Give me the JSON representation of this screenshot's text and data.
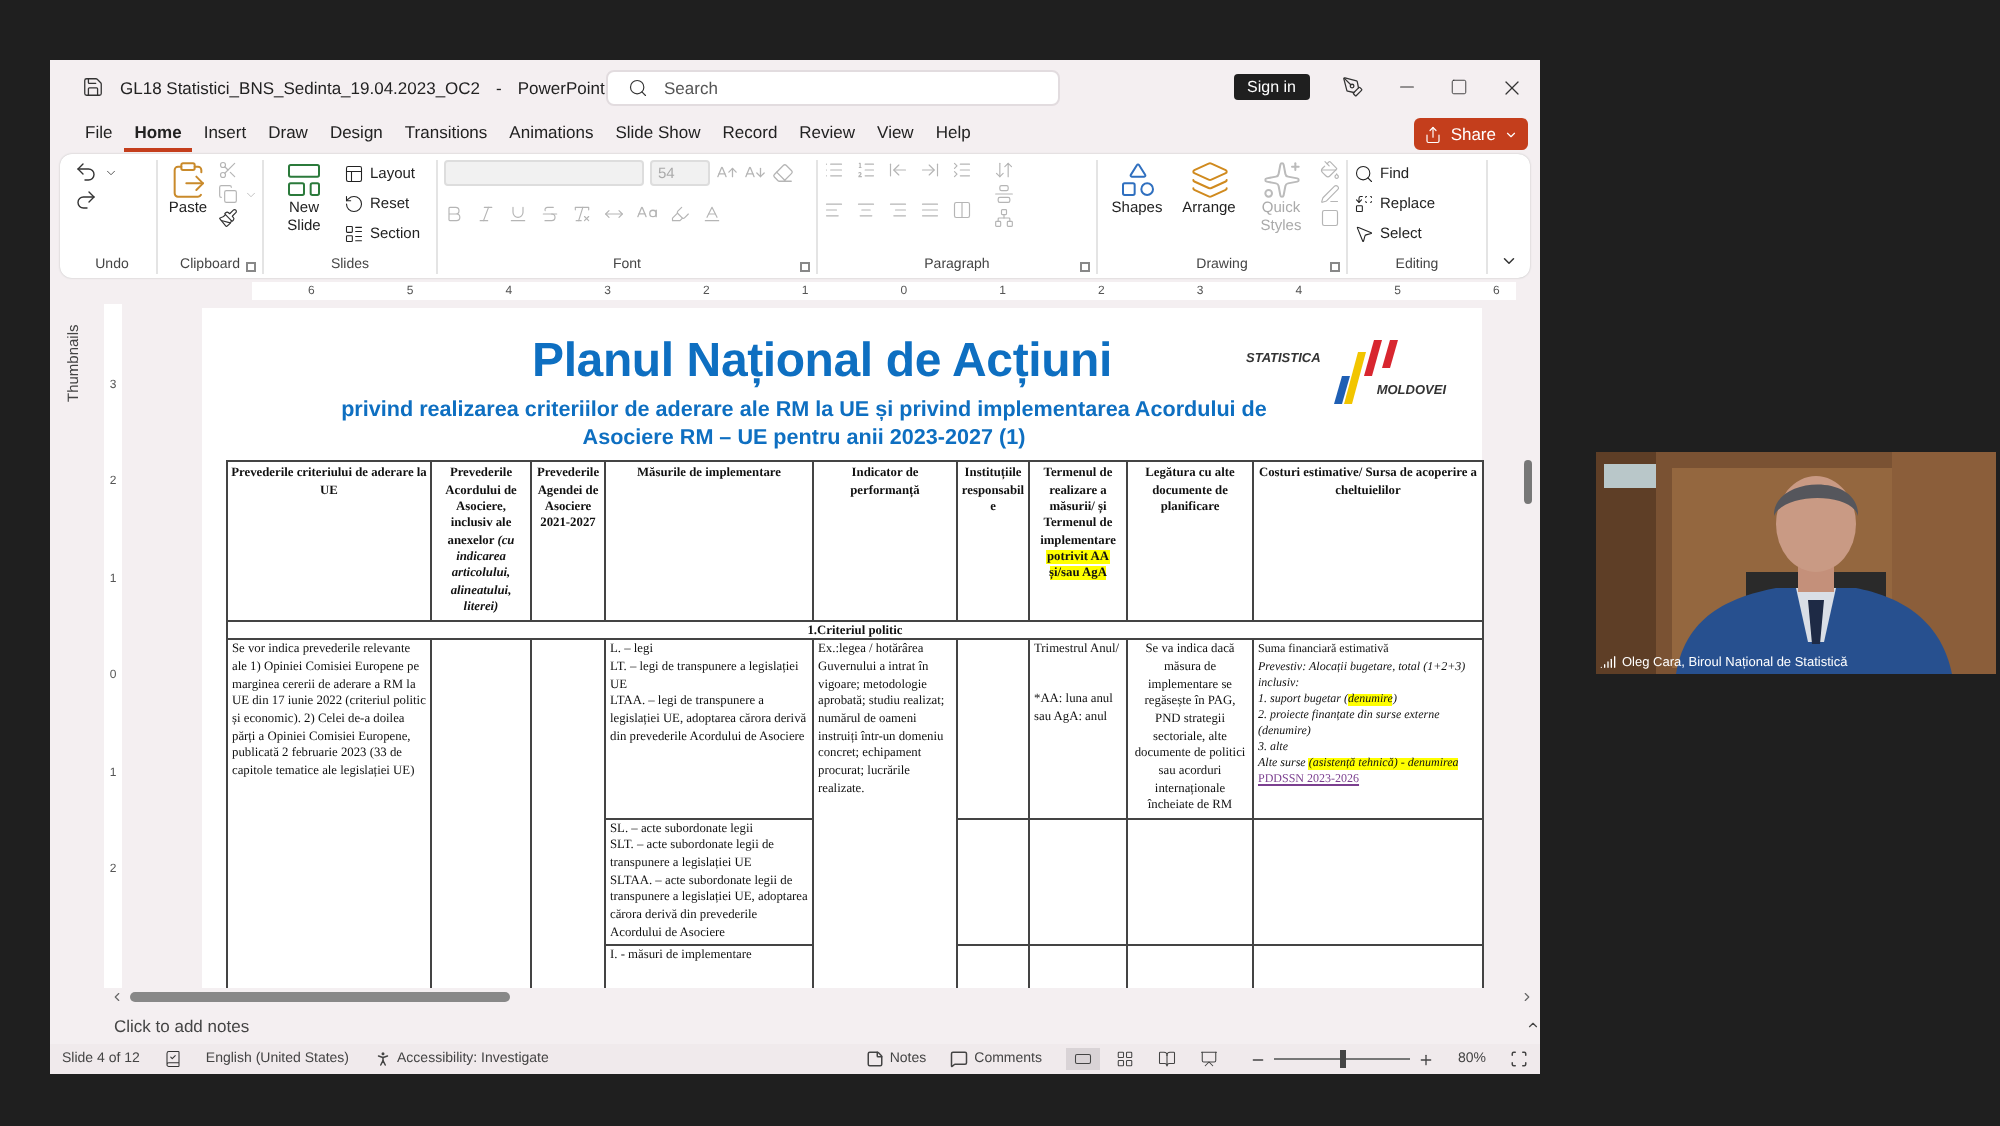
{
  "window": {
    "title": "GL18 Statistici_BNS_Sedinta_19.04.2023_OC2",
    "separator": "-",
    "app": "PowerPoint"
  },
  "search": {
    "placeholder": "Search"
  },
  "sign_in": "Sign in",
  "menu_tabs": [
    {
      "label": "File",
      "selected": false
    },
    {
      "label": "Home",
      "selected": true
    },
    {
      "label": "Insert",
      "selected": false
    },
    {
      "label": "Draw",
      "selected": false
    },
    {
      "label": "Design",
      "selected": false
    },
    {
      "label": "Transitions",
      "selected": false
    },
    {
      "label": "Animations",
      "selected": false
    },
    {
      "label": "Slide Show",
      "selected": false
    },
    {
      "label": "Record",
      "selected": false
    },
    {
      "label": "Review",
      "selected": false
    },
    {
      "label": "View",
      "selected": false
    },
    {
      "label": "Help",
      "selected": false
    }
  ],
  "share": "Share",
  "ribbon": {
    "undo": {
      "label": "Undo"
    },
    "clipboard": {
      "label": "Clipboard",
      "paste": "Paste"
    },
    "slides": {
      "label": "Slides",
      "new_slide": "New Slide",
      "layout": "Layout",
      "reset": "Reset",
      "section": "Section"
    },
    "font": {
      "label": "Font",
      "size": "54",
      "disabled": true
    },
    "paragraph": {
      "label": "Paragraph"
    },
    "drawing": {
      "label": "Drawing",
      "shapes": "Shapes",
      "arrange": "Arrange",
      "quick_styles": {
        "label": "Quick Styles",
        "disabled": true
      }
    },
    "editing": {
      "label": "Editing",
      "find": "Find",
      "replace": "Replace",
      "select": "Select"
    }
  },
  "thumbnails_pane": {
    "label": "Thumbnails"
  },
  "rulers": {
    "horizontal": [
      "6",
      "5",
      "4",
      "3",
      "2",
      "1",
      "0",
      "1",
      "2",
      "3",
      "4",
      "5",
      "6"
    ],
    "vertical": [
      "3",
      "2",
      "1",
      "0",
      "1",
      "2"
    ]
  },
  "slide": {
    "title": "Planul Național de Acțiuni",
    "subtitle": "privind realizarea criteriilor de aderare ale RM la UE și privind implementarea Acordului de Asociere RM – UE pentru anii 2023-2027 (1)",
    "logo": {
      "top": "STATISTICA",
      "bottom": "MOLDOVEI"
    },
    "table": {
      "columns": [
        {
          "segments": [
            {
              "text": "Prevederile criteriului de aderare la UE",
              "highlight": false
            }
          ]
        },
        {
          "segments": [
            {
              "text": "Prevederile Acordului de Asociere, inclusiv ale anexelor *(cu indicarea articolului, alineatului, literei)*",
              "highlight": false
            }
          ]
        },
        {
          "segments": [
            {
              "text": "Prevederile Agendei de Asociere 2021-2027",
              "highlight": false
            }
          ]
        },
        {
          "segments": [
            {
              "text": "Măsurile de implementare",
              "highlight": false
            }
          ]
        },
        {
          "segments": [
            {
              "text": "Indicator de performanță",
              "highlight": false
            }
          ]
        },
        {
          "segments": [
            {
              "text": "Instituțiile responsabile",
              "highlight": false
            }
          ]
        },
        {
          "segments": [
            {
              "text": "Termenul de realizare a măsurii/ și Termenul de implementare ",
              "highlight": false
            },
            {
              "text": "potrivit AA și/sau AgA",
              "highlight": true
            }
          ]
        },
        {
          "segments": [
            {
              "text": "Legătura cu alte documente de planificare",
              "highlight": false
            }
          ]
        },
        {
          "segments": [
            {
              "text": "Costuri estimative/ Sursa de acoperire a cheltuielilor",
              "highlight": false
            }
          ]
        }
      ],
      "section": "1.Criteriul politic",
      "body": {
        "criteria": "Se vor indica prevederile relevante ale 1) Opiniei Comisiei Europene pe marginea cererii de aderare a RM la UE din 17 iunie 2022 (criteriul politic și economic). 2) Celei de-a doilea părți a Opiniei Comisiei Europene, publicată 2 februarie 2023 (33 de capitole tematice ale legislației UE)",
        "measures": [
          [
            "L. – legi",
            "LT. – legi de transpunere a legislației UE",
            "LTAA. – legi de transpunere a legislației UE, adoptarea cărora derivă din prevederile Acordului de Asociere"
          ],
          [
            "SL. – acte subordonate legii",
            "SLT. – acte subordonate legii de transpunere a legislației UE",
            "SLTAA. – acte subordonate legii de transpunere a legislației UE, adoptarea cărora derivă din prevederile Acordului de Asociere"
          ],
          [
            "I. - măsuri de implementare"
          ]
        ],
        "indicator": "Ex.:legea / hotărârea Guvernului a intrat în vigoare; metodologie aprobată; studiu realizat;  numărul de oameni instruiți într-un domeniu concret; echipament procurat; lucrările realizate.",
        "deadline": [
          "Trimestrul Anul/",
          "*AA: luna anul sau AgA: anul"
        ],
        "planning": "Se va indica dacă măsura de implementare se regăsește în PAG, PND strategii sectoriale, alte documente de politici sau acorduri internaționale încheiate de RM",
        "costs": [
          {
            "kind": "plain",
            "segments": [
              {
                "text": "Suma financiară estimativă",
                "highlight": false
              }
            ]
          },
          {
            "kind": "italic",
            "segments": [
              {
                "text": "Prevestiv:  Alocații  bugetare, total (1+2+3)",
                "highlight": false
              }
            ]
          },
          {
            "kind": "italic",
            "segments": [
              {
                "text": "inclusiv:",
                "highlight": false
              }
            ]
          },
          {
            "kind": "italic",
            "segments": [
              {
                "text": "1. suport bugetar (",
                "highlight": false
              },
              {
                "text": "denumire",
                "highlight": true
              },
              {
                "text": ")",
                "highlight": false
              }
            ]
          },
          {
            "kind": "italic",
            "segments": [
              {
                "text": "2. proiecte finanțate din surse externe (denumire)",
                "highlight": false
              }
            ]
          },
          {
            "kind": "italic",
            "segments": [
              {
                "text": "3. alte",
                "highlight": false
              }
            ]
          },
          {
            "kind": "italic",
            "segments": [
              {
                "text": "Alte surse ",
                "highlight": false
              },
              {
                "text": "(asistență tehnică) - denumirea",
                "highlight": true
              }
            ]
          },
          {
            "kind": "link",
            "segments": [
              {
                "text": "PDDSSN 2023-2026",
                "highlight": false
              }
            ]
          }
        ]
      }
    }
  },
  "notes": {
    "placeholder": "Click to add notes"
  },
  "status_bar": {
    "slide": "Slide 4 of 12",
    "language": "English (United States)",
    "accessibility": "Accessibility: Investigate",
    "notes": "Notes",
    "comments": "Comments",
    "views": [
      {
        "kind": "normal",
        "selected": true
      },
      {
        "kind": "sorter",
        "selected": false
      },
      {
        "kind": "reading",
        "selected": false
      },
      {
        "kind": "slideshow",
        "selected": false
      }
    ],
    "zoom": {
      "level": 0.5,
      "reading": "80%"
    }
  },
  "video": {
    "caption": "Oleg Cara, Biroul Național de Statistică"
  }
}
